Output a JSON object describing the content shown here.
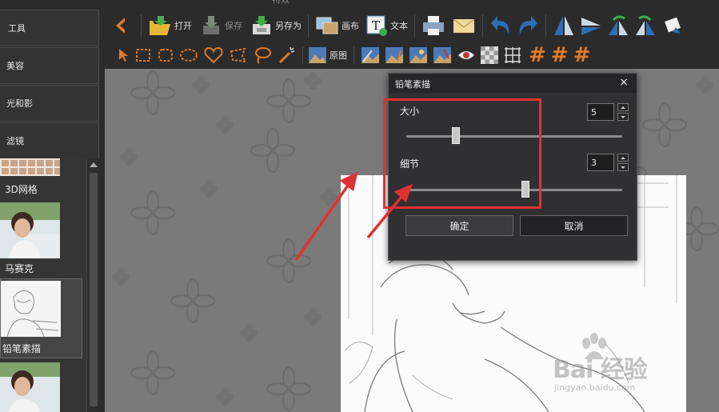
{
  "window_title": "特效",
  "nav": [
    {
      "label": "工具"
    },
    {
      "label": "美容"
    },
    {
      "label": "光和影"
    },
    {
      "label": "滤镜"
    }
  ],
  "effects": [
    {
      "label": "3D网格"
    },
    {
      "label": "马赛克"
    },
    {
      "label": "铅笔素描",
      "selected": true
    },
    {
      "label": ""
    }
  ],
  "toolbar": {
    "open": "打开",
    "save": "保存",
    "save_as": "另存为",
    "canvas": "画布",
    "text": "文本",
    "original": "原图"
  },
  "dialog": {
    "title": "铅笔素描",
    "close": "×",
    "size_label": "大小",
    "size_value": "5",
    "size_fraction": 0.23,
    "detail_label": "细节",
    "detail_value": "3",
    "detail_fraction": 0.55,
    "ok": "确定",
    "cancel": "取消"
  },
  "watermark": {
    "brand": "Bai 经验",
    "url": "jingyan.baidu.com"
  },
  "colors": {
    "accent_orange": "#e07a2a",
    "annotation_red": "#e03232",
    "icon_blue": "#2f6db3"
  }
}
